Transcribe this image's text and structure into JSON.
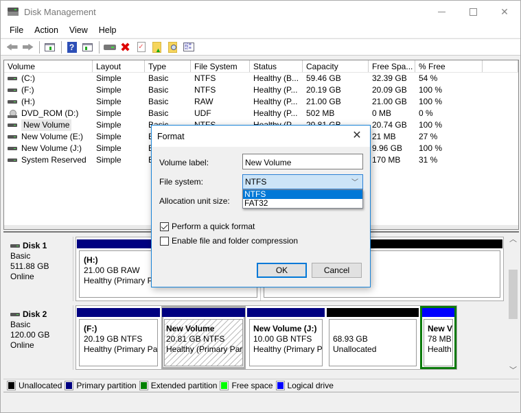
{
  "window": {
    "title": "Disk Management",
    "controls": [
      "minimize",
      "maximize",
      "close"
    ]
  },
  "menubar": {
    "items": [
      "File",
      "Action",
      "View",
      "Help"
    ]
  },
  "toolbar": {
    "buttons": [
      {
        "icon": "back-arrow-icon",
        "label": "Back"
      },
      {
        "icon": "forward-arrow-icon",
        "label": "Forward"
      },
      {
        "icon": "show-hide-console-tree-icon",
        "label": "Show/Hide Console Tree"
      },
      {
        "icon": "help-icon",
        "label": "Help"
      },
      {
        "icon": "show-hide-action-pane-icon",
        "label": "Show/Hide Action Pane"
      },
      {
        "icon": "connect-drive-icon",
        "label": "Connect Virtual Disk"
      },
      {
        "icon": "delete-icon",
        "label": "Delete"
      },
      {
        "icon": "check-doc-icon",
        "label": "Properties"
      },
      {
        "icon": "folder-up-icon",
        "label": "Up"
      },
      {
        "icon": "folder-search-icon",
        "label": "Search"
      },
      {
        "icon": "checklist-icon",
        "label": "Checklist"
      }
    ]
  },
  "volume_list": {
    "columns": [
      "Volume",
      "Layout",
      "Type",
      "File System",
      "Status",
      "Capacity",
      "Free Spa...",
      "% Free"
    ],
    "rows": [
      {
        "icon": "drive",
        "volume": "(C:)",
        "layout": "Simple",
        "type": "Basic",
        "fs": "NTFS",
        "status": "Healthy (B...",
        "capacity": "59.46 GB",
        "free": "32.39 GB",
        "pct": "54 %"
      },
      {
        "icon": "drive",
        "volume": "(F:)",
        "layout": "Simple",
        "type": "Basic",
        "fs": "NTFS",
        "status": "Healthy (P...",
        "capacity": "20.19 GB",
        "free": "20.09 GB",
        "pct": "100 %"
      },
      {
        "icon": "drive",
        "volume": "(H:)",
        "layout": "Simple",
        "type": "Basic",
        "fs": "RAW",
        "status": "Healthy (P...",
        "capacity": "21.00 GB",
        "free": "21.00 GB",
        "pct": "100 %"
      },
      {
        "icon": "dvd",
        "volume": "DVD_ROM (D:)",
        "layout": "Simple",
        "type": "Basic",
        "fs": "UDF",
        "status": "Healthy (P...",
        "capacity": "502 MB",
        "free": "0 MB",
        "pct": "0 %"
      },
      {
        "icon": "drive",
        "volume": "New Volume",
        "layout": "Simple",
        "type": "Basic",
        "fs": "NTFS",
        "status": "Healthy (P...",
        "capacity": "20.81 GB",
        "free": "20.74 GB",
        "pct": "100 %",
        "selected": true
      },
      {
        "icon": "drive",
        "volume": "New Volume (E:)",
        "layout": "Simple",
        "type": "Basic",
        "fs": "",
        "status": "",
        "capacity": "",
        "free": "21 MB",
        "pct": "27 %"
      },
      {
        "icon": "drive",
        "volume": "New Volume (J:)",
        "layout": "Simple",
        "type": "Basic",
        "fs": "",
        "status": "",
        "capacity": "",
        "free": "9.96 GB",
        "pct": "100 %"
      },
      {
        "icon": "drive",
        "volume": "System Reserved",
        "layout": "Simple",
        "type": "Basic",
        "fs": "",
        "status": "",
        "capacity": "",
        "free": "170 MB",
        "pct": "31 %"
      }
    ]
  },
  "disks": [
    {
      "name": "Disk 1",
      "type": "Basic",
      "size": "511.88 GB",
      "status": "Online",
      "partitions": [
        {
          "name": "(H:)",
          "size_fs": "21.00 GB RAW",
          "status": "Healthy (Primary Pa",
          "kind": "primary"
        },
        {
          "name": "",
          "size_fs": "",
          "status": "",
          "kind": "unallocated"
        }
      ]
    },
    {
      "name": "Disk 2",
      "type": "Basic",
      "size": "120.00 GB",
      "status": "Online",
      "partitions": [
        {
          "name": "(F:)",
          "size_fs": "20.19 GB NTFS",
          "status": "Healthy (Primary Par",
          "kind": "primary"
        },
        {
          "name": "New Volume",
          "size_fs": "20.81 GB NTFS",
          "status": "Healthy (Primary Par",
          "kind": "primary",
          "selected": true
        },
        {
          "name": "New Volume  (J:)",
          "size_fs": "10.00 GB NTFS",
          "status": "Healthy (Primary P",
          "kind": "primary"
        },
        {
          "name": "",
          "size_fs": "68.93 GB",
          "status": "Unallocated",
          "kind": "unallocated"
        },
        {
          "name": "New V",
          "size_fs": "78 MB",
          "status": "Health",
          "kind": "logical",
          "focused": true
        }
      ]
    }
  ],
  "legend": [
    {
      "label": "Unallocated",
      "color": "#000000"
    },
    {
      "label": "Primary partition",
      "color": "#000080"
    },
    {
      "label": "Extended partition",
      "color": "#008000"
    },
    {
      "label": "Free space",
      "color": "#00ff00"
    },
    {
      "label": "Logical drive",
      "color": "#0000ff"
    }
  ],
  "format_dialog": {
    "title": "Format",
    "volume_label_label": "Volume label:",
    "volume_label_value": "New Volume",
    "file_system_label": "File system:",
    "file_system_value": "NTFS",
    "file_system_options": [
      "NTFS",
      "FAT32"
    ],
    "file_system_highlighted": "NTFS",
    "allocation_label": "Allocation unit size:",
    "quick_format_label": "Perform a quick format",
    "quick_format_checked": true,
    "compression_label": "Enable file and folder compression",
    "compression_checked": false,
    "ok_label": "OK",
    "cancel_label": "Cancel"
  },
  "colors": {
    "primary": "#000080",
    "unallocated": "#000000",
    "logical": "#0000ff",
    "selection_focus": "#0b7a0b",
    "accent": "#0078d7"
  }
}
